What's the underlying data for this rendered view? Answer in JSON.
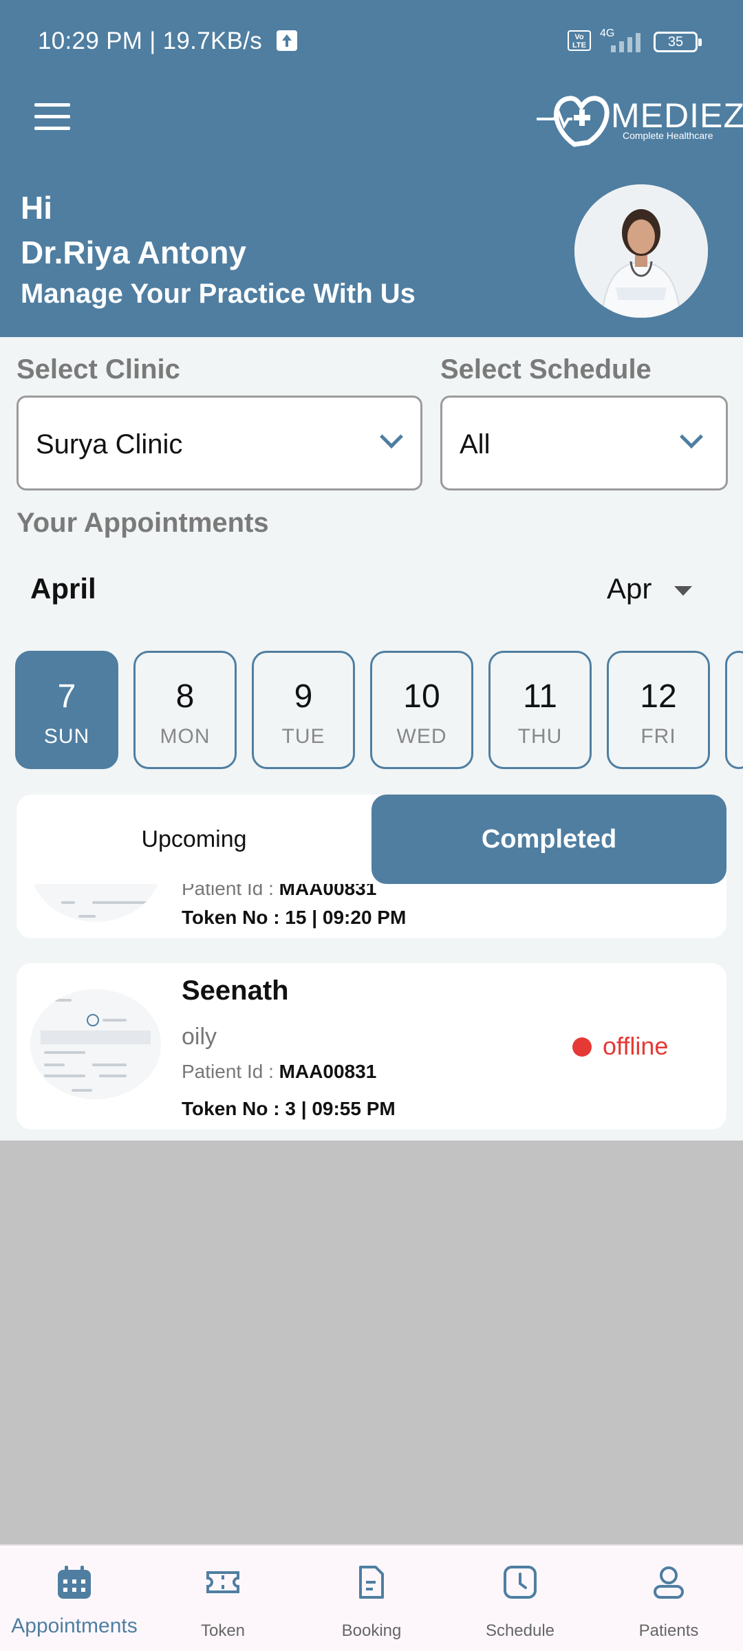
{
  "status_bar": {
    "time": "10:29 PM | 19.7KB/s",
    "network": "4G",
    "volte": "Vo LTE",
    "battery": "35"
  },
  "header": {
    "logo_text": "MEDIEZY",
    "logo_subtitle": "Complete Healthcare",
    "greeting": "Hi",
    "doctor_name": "Dr.Riya Antony",
    "tagline": "Manage Your Practice With Us"
  },
  "filters": {
    "clinic_label": "Select Clinic",
    "clinic_value": "Surya Clinic",
    "schedule_label": "Select Schedule",
    "schedule_value": "All"
  },
  "appointments": {
    "section_title": "Your Appointments",
    "month": "April",
    "month_select": "Apr",
    "days": [
      {
        "num": "7",
        "name": "SUN"
      },
      {
        "num": "8",
        "name": "MON"
      },
      {
        "num": "9",
        "name": "TUE"
      },
      {
        "num": "10",
        "name": "WED"
      },
      {
        "num": "11",
        "name": "THU"
      },
      {
        "num": "12",
        "name": "FRI"
      }
    ],
    "tabs": {
      "upcoming": "Upcoming",
      "completed": "Completed"
    },
    "list": [
      {
        "patient_id_label": "Patient Id :",
        "patient_id": "MAA00831",
        "token": "Token No : 15 | 09:20 PM"
      },
      {
        "name": "Seenath",
        "condition": "oily",
        "patient_id_label": "Patient Id :",
        "patient_id": "MAA00831",
        "token": "Token No : 3 | 09:55 PM",
        "status": "offline"
      }
    ]
  },
  "nav": {
    "appointments": "Appointments",
    "token": "Token",
    "booking": "Booking",
    "schedule": "Schedule",
    "patients": "Patients"
  },
  "colors": {
    "primary": "#4f7ea1",
    "offline": "#e53935",
    "background": "#f1f5f5"
  }
}
